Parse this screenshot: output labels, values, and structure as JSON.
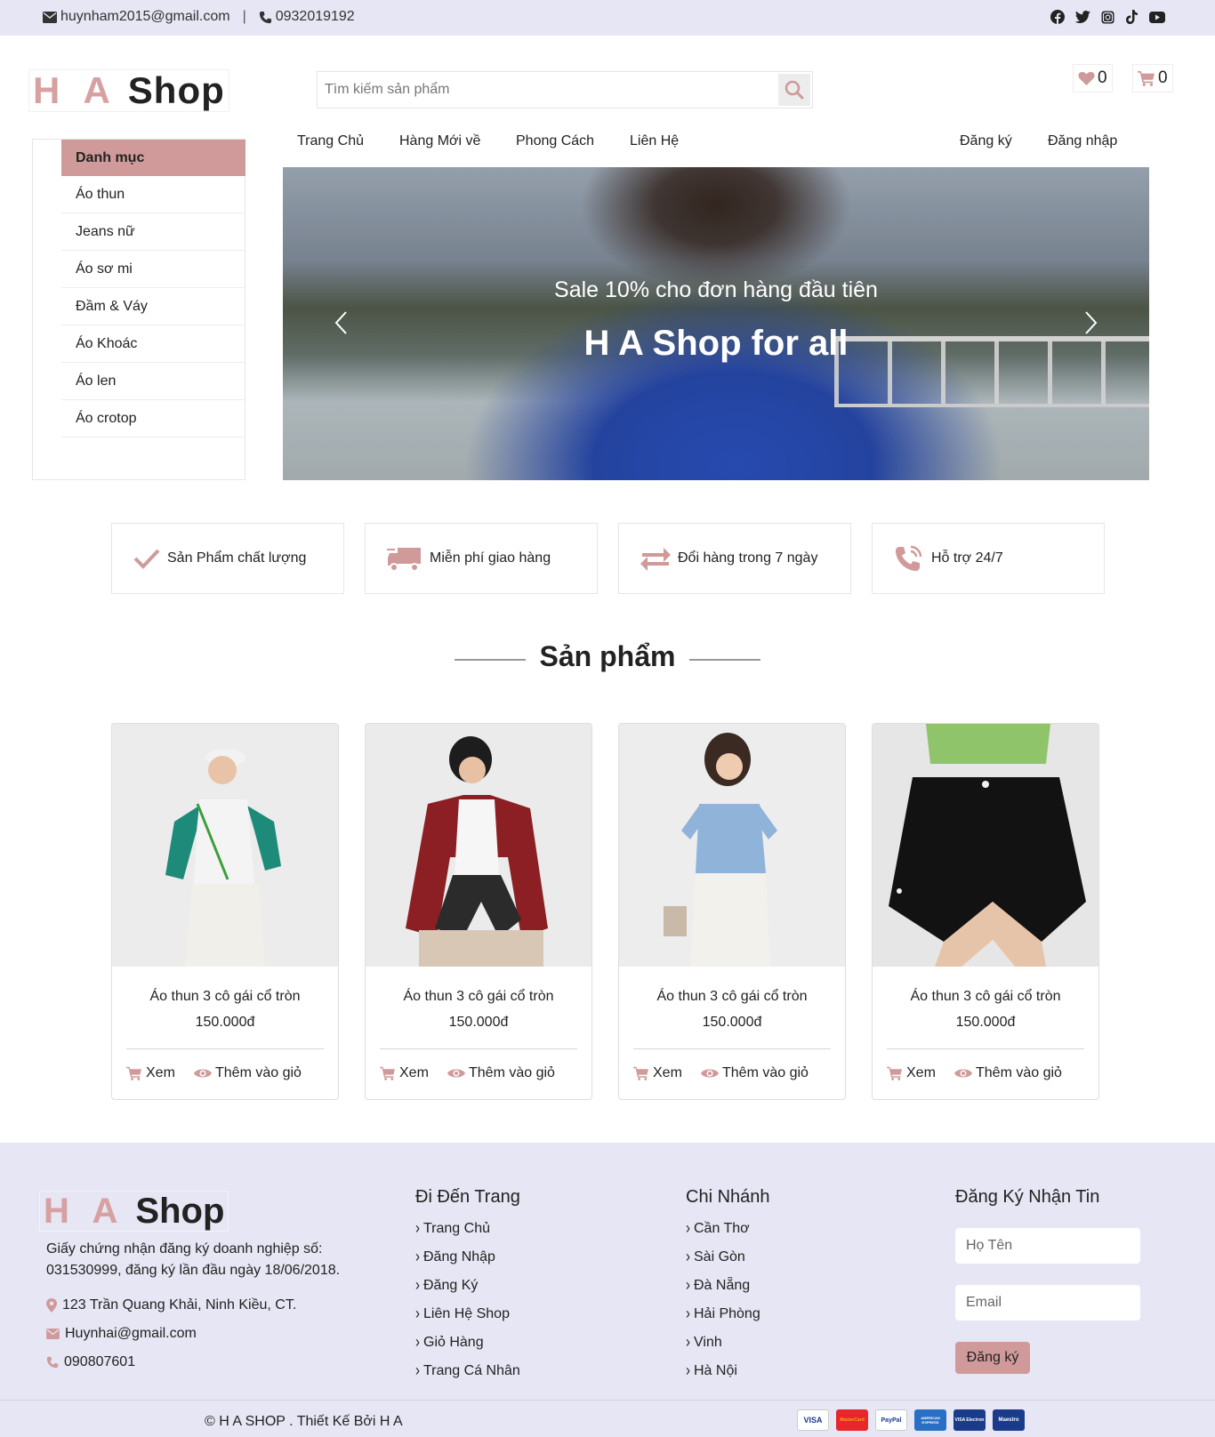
{
  "topbar": {
    "email": "huynham2015@gmail.com",
    "separator": "|",
    "phone": "0932019192",
    "socials": [
      "facebook-icon",
      "twitter-icon",
      "instagram-icon",
      "tiktok-icon",
      "youtube-icon"
    ]
  },
  "header": {
    "logo_ha": "H A",
    "logo_shop": "Shop",
    "search_placeholder": "Tìm kiếm sản phẩm",
    "wishlist_count": "0",
    "cart_count": "0"
  },
  "sidebar": {
    "title": "Danh mục",
    "items": [
      "Áo thun",
      "Jeans nữ",
      "Áo sơ mi",
      "Đầm & Váy",
      "Áo Khoác",
      "Áo len",
      "Áo crotop"
    ]
  },
  "nav": {
    "items": [
      "Trang Chủ",
      "Hàng Mới về",
      "Phong Cách",
      "Liên Hệ"
    ],
    "register": "Đăng ký",
    "login": "Đăng nhập"
  },
  "banner": {
    "subtitle": "Sale 10% cho đơn hàng đầu tiên",
    "title": "H A Shop for all"
  },
  "features": [
    "Sản Phẩm chất lượng",
    "Miễn phí giao hàng",
    "Đổi hàng trong 7 ngày",
    "Hỗ trợ 24/7"
  ],
  "products_section": {
    "title": "Sản phẩm",
    "items": [
      {
        "name": "Áo thun 3 cô gái cổ tròn",
        "price": "150.000đ",
        "view": "Xem",
        "add": "Thêm vào giỏ"
      },
      {
        "name": "Áo thun 3 cô gái cổ tròn",
        "price": "150.000đ",
        "view": "Xem",
        "add": "Thêm vào giỏ"
      },
      {
        "name": "Áo thun 3 cô gái cổ tròn",
        "price": "150.000đ",
        "view": "Xem",
        "add": "Thêm vào giỏ"
      },
      {
        "name": "Áo thun 3 cô gái cổ tròn",
        "price": "150.000đ",
        "view": "Xem",
        "add": "Thêm vào giỏ"
      }
    ]
  },
  "footer": {
    "logo_ha": "H A",
    "logo_shop": "Shop",
    "description": "Giấy chứng nhận đăng ký doanh nghiệp số: 031530999, đăng ký lần đầu ngày 18/06/2018.",
    "address": "123 Trần Quang Khải, Ninh Kiều, CT.",
    "email": "Huynhai@gmail.com",
    "phone": "090807601",
    "pages_title": "Đi Đến Trang",
    "pages": [
      "Trang Chủ",
      "Đăng Nhập",
      "Đăng Ký",
      "Liên Hệ Shop",
      "Giỏ Hàng",
      "Trang Cá Nhân"
    ],
    "branches_title": "Chi Nhánh",
    "branches": [
      "Cần Thơ",
      "Sài Gòn",
      "Đà Nẵng",
      "Hải Phòng",
      "Vinh",
      "Hà Nội"
    ],
    "newsletter_title": "Đăng Ký Nhận Tin",
    "name_placeholder": "Họ Tên",
    "email_placeholder": "Email",
    "subscribe": "Đăng ký",
    "copyright": "© H A SHOP . Thiết Kế Bởi H A",
    "payments": [
      {
        "icon": "visa-icon",
        "label": "VISA"
      },
      {
        "icon": "mastercard-icon",
        "label": "MasterCard"
      },
      {
        "icon": "paypal-icon",
        "label": "PayPal"
      },
      {
        "icon": "amex-icon",
        "label": "AMERICAN EXPRESS"
      },
      {
        "icon": "visa-electron-icon",
        "label": "VISA Electron"
      },
      {
        "icon": "maestro-icon",
        "label": "Maestro"
      }
    ]
  },
  "colors": {
    "accent": "#d09a9a",
    "topbar_bg": "#e6e6f4",
    "footer_bg": "#e6e6f4"
  }
}
